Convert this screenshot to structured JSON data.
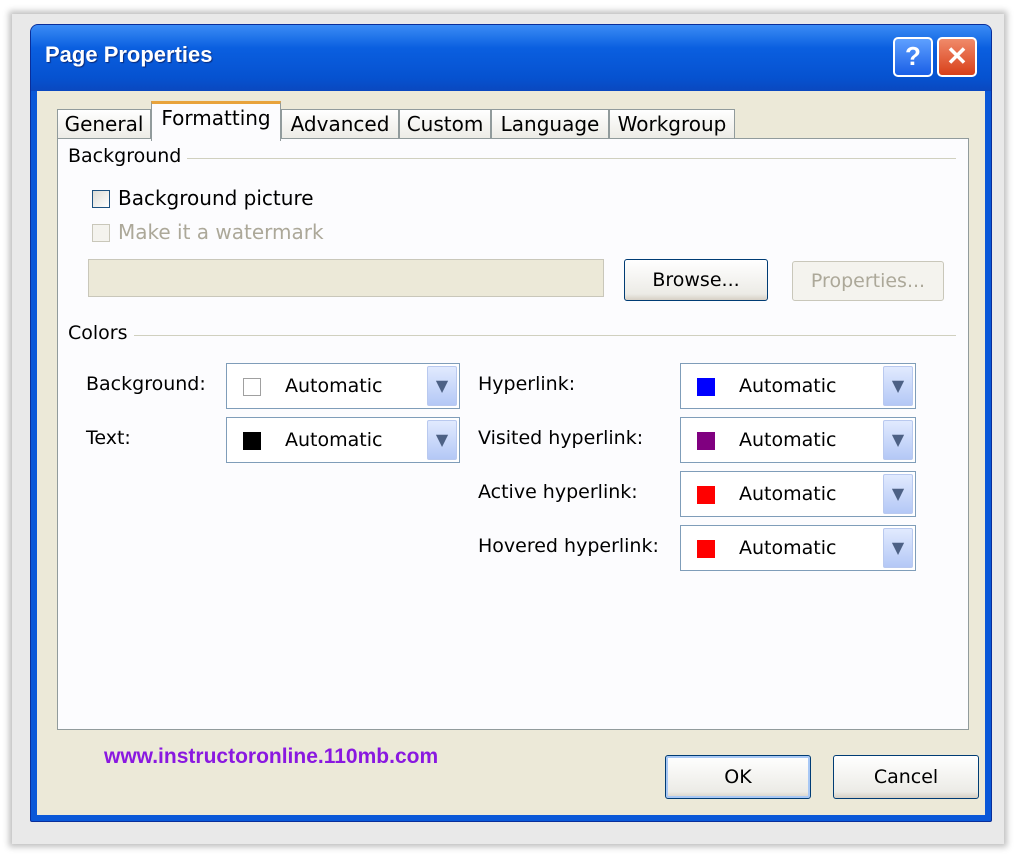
{
  "window": {
    "title": "Page Properties",
    "help_glyph": "?",
    "close_glyph": "✕"
  },
  "tabs": [
    {
      "label": "General"
    },
    {
      "label": "Formatting"
    },
    {
      "label": "Advanced"
    },
    {
      "label": "Custom"
    },
    {
      "label": "Language"
    },
    {
      "label": "Workgroup"
    }
  ],
  "active_tab": "Formatting",
  "background_group": {
    "label": "Background",
    "background_picture": {
      "label": "Background picture",
      "checked": false
    },
    "make_watermark": {
      "label": "Make it a watermark",
      "checked": false,
      "disabled": true
    },
    "picture_path": "",
    "browse_label": "Browse...",
    "properties_label": "Properties..."
  },
  "colors_group": {
    "label": "Colors",
    "items": [
      {
        "label": "Background:",
        "value": "Automatic",
        "swatch": "#ffffff"
      },
      {
        "label": "Text:",
        "value": "Automatic",
        "swatch": "#000000"
      },
      {
        "label": "Hyperlink:",
        "value": "Automatic",
        "swatch": "#0000ff"
      },
      {
        "label": "Visited hyperlink:",
        "value": "Automatic",
        "swatch": "#800080"
      },
      {
        "label": "Active hyperlink:",
        "value": "Automatic",
        "swatch": "#ff0000"
      },
      {
        "label": "Hovered hyperlink:",
        "value": "Automatic",
        "swatch": "#ff0000"
      }
    ]
  },
  "watermark_text": "www.instructoronline.110mb.com",
  "buttons": {
    "ok": "OK",
    "cancel": "Cancel"
  },
  "icons": [
    "help-icon",
    "close-icon",
    "chevron-down-icon"
  ]
}
